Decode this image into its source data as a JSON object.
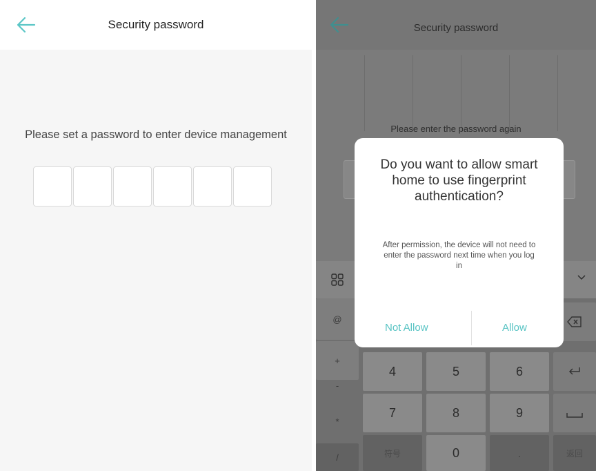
{
  "left_screen": {
    "header": {
      "back_icon": "arrow-left-icon",
      "title": "Security password"
    },
    "prompt": "Please set a password to enter device management",
    "password_boxes": [
      "",
      "",
      "",
      "",
      "",
      ""
    ]
  },
  "right_screen": {
    "header": {
      "back_icon": "arrow-left-icon",
      "title": "Security password"
    },
    "prompt": "Please enter the password again",
    "dialog": {
      "title": "Do you want to allow smart home to use fingerprint authentication?",
      "body": "After permission, the device will not need to enter the password next time when you log in",
      "deny_label": "Not Allow",
      "allow_label": "Allow"
    },
    "keyboard": {
      "side_keys": [
        "@",
        "+",
        "-",
        "*",
        "/"
      ],
      "rows": [
        [
          "4",
          "5",
          "6"
        ],
        [
          "7",
          "8",
          "9"
        ],
        [
          "符号",
          "0",
          "."
        ]
      ],
      "return_label": "返回",
      "icons": [
        "grid-icon",
        "chevron-down-icon",
        "backspace-icon",
        "enter-icon",
        "space-icon"
      ]
    }
  },
  "colors": {
    "accent": "#5ac6c6",
    "overlay": "#7b7b7b",
    "dialog_bg": "#ffffff"
  }
}
